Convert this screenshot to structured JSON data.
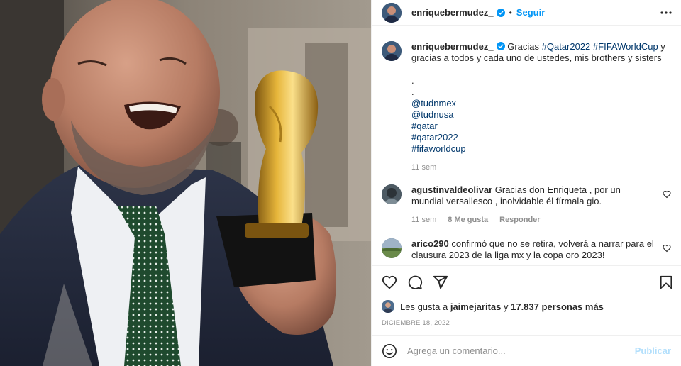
{
  "post": {
    "author": "enriquebermudez_",
    "follow_label": "Seguir",
    "dot": "•",
    "verified_color": "#0095f6",
    "accent": "#0095f6"
  },
  "caption": {
    "author": "enriquebermudez_",
    "text_before": "Gracias ",
    "tag1": "#Qatar2022",
    "space": " ",
    "tag2": "#FIFAWorldCup",
    "text_after": " y gracias a todos y cada uno de ustedes, mis brothers y sisters",
    "dot1": ".",
    "dot2": ".",
    "mentions": [
      "@tudnmex",
      "@tudnusa"
    ],
    "hashtags": [
      "#qatar",
      "#qatar2022",
      "#fifaworldcup"
    ],
    "time": "11 sem"
  },
  "comments": [
    {
      "user": "agustinvaldeolivar",
      "text": "Gracias don Enriqueta , por un mundial versallesco , inolvidable él fírmala gio.",
      "time": "11 sem",
      "likes": "8 Me gusta",
      "reply": "Responder"
    },
    {
      "user": "arico290",
      "text": "confirmó que no se retira, volverá a narrar para el clausura 2023 de la liga mx y la copa oro 2023!"
    }
  ],
  "icons": {
    "more": "more-horizontal-icon",
    "like": "heart-icon",
    "comment": "comment-icon",
    "share": "share-icon",
    "save": "bookmark-icon",
    "emoji": "emoji-icon"
  },
  "likes_line": {
    "prefix": "Les gusta a ",
    "user": "jaimejaritas",
    "middle": " y ",
    "count": "17.837 personas más"
  },
  "date": "DICIEMBRE 18, 2022",
  "composer": {
    "placeholder": "Agrega un comentario...",
    "post_label": "Publicar"
  }
}
